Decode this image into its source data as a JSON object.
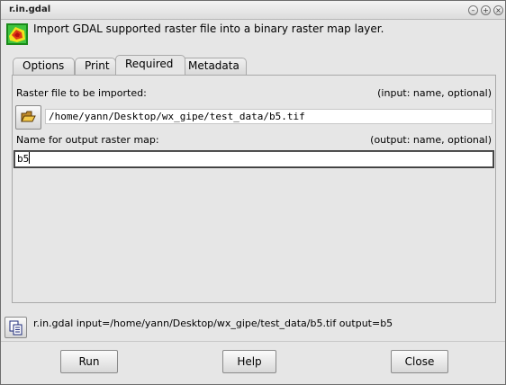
{
  "window": {
    "title": "r.in.gdal",
    "controls": [
      "minimize-icon",
      "maximize-icon",
      "close-icon"
    ]
  },
  "header": {
    "icon": "gdal-raster-icon",
    "description": "Import GDAL supported raster file into a binary raster map layer."
  },
  "tabs": [
    {
      "label": "Options",
      "active": false
    },
    {
      "label": "Print",
      "active": false
    },
    {
      "label": "Required",
      "active": true
    },
    {
      "label": "Metadata",
      "active": false
    }
  ],
  "required": {
    "input_label": "Raster file to be imported:",
    "input_hint": "(input:  name, optional)",
    "input_value": "/home/yann/Desktop/wx_gipe/test_data/b5.tif",
    "browse_icon": "folder-open-icon",
    "output_label": "Name for output raster map:",
    "output_hint": "(output:  name, optional)",
    "output_value": "b5"
  },
  "command": {
    "copy_icon": "copy-icon",
    "text": "r.in.gdal input=/home/yann/Desktop/wx_gipe/test_data/b5.tif output=b5"
  },
  "buttons": {
    "run": "Run",
    "help": "Help",
    "close": "Close"
  }
}
